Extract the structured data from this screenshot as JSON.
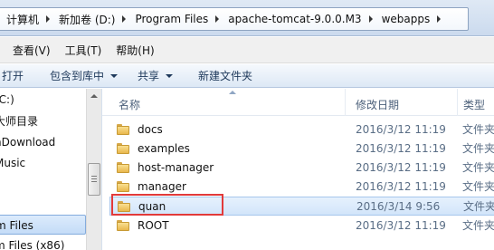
{
  "address_bar": {
    "crumbs": [
      "计算机",
      "新加卷 (D:)",
      "Program Files",
      "apache-tomcat-9.0.0.M3",
      "webapps"
    ]
  },
  "menu_bar": {
    "items": [
      "查看(V)",
      "工具(T)",
      "帮助(H)"
    ]
  },
  "toolbar": {
    "open": "打开",
    "include_in_library": "包含到库中",
    "share": "共享",
    "new_folder": "新建文件夹"
  },
  "nav_pane": {
    "items": [
      {
        "label": "(C:)",
        "selected": false
      },
      {
        "label": "大师目录",
        "selected": false
      },
      {
        "label": "nDownload",
        "selected": false
      },
      {
        "label": "Music",
        "selected": false
      },
      {
        "label": "",
        "selected": false
      },
      {
        "label": "",
        "selected": false
      },
      {
        "label": "m Files",
        "selected": true
      },
      {
        "label": "m Files (x86)",
        "selected": false
      }
    ]
  },
  "file_list": {
    "columns": {
      "name": "名称",
      "date": "修改日期",
      "type": "类型"
    },
    "rows": [
      {
        "name": "docs",
        "date": "2016/3/12 11:19",
        "type": "文件夹",
        "selected": false
      },
      {
        "name": "examples",
        "date": "2016/3/12 11:19",
        "type": "文件夹",
        "selected": false
      },
      {
        "name": "host-manager",
        "date": "2016/3/12 11:19",
        "type": "文件夹",
        "selected": false
      },
      {
        "name": "manager",
        "date": "2016/3/12 11:19",
        "type": "文件夹",
        "selected": false
      },
      {
        "name": "quan",
        "date": "2016/3/14 9:56",
        "type": "文件夹",
        "selected": true
      },
      {
        "name": "ROOT",
        "date": "2016/3/12 11:19",
        "type": "文件夹",
        "selected": false
      }
    ]
  },
  "colors": {
    "highlight_box": "#e23a3a",
    "folder": "#e9b84d",
    "selection": "#d2e5fa"
  },
  "icons": {
    "folder": "folder-icon",
    "dropdown": "chevron-down-icon",
    "breadcrumb_separator": "chevron-right-icon",
    "sort_indicator": "sort-ascending-icon"
  }
}
